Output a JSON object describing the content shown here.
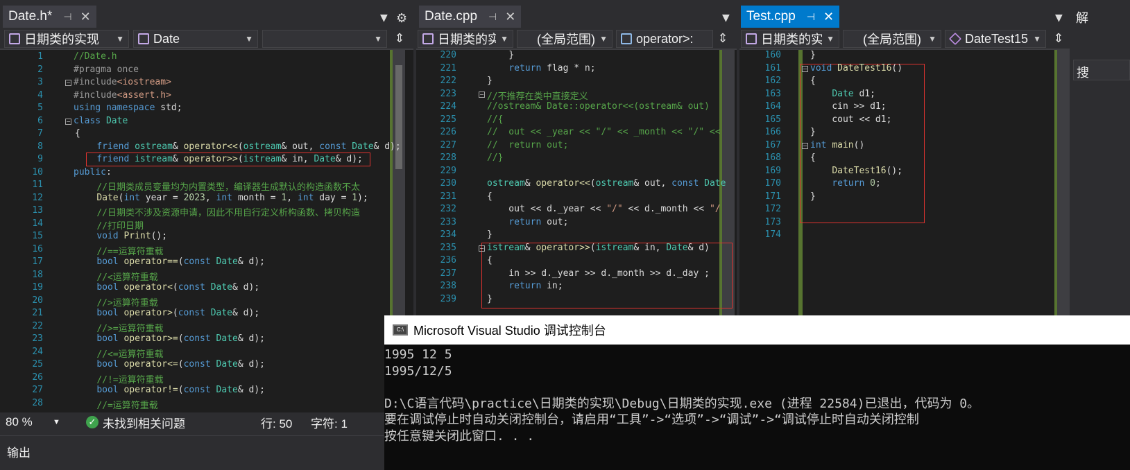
{
  "panes": [
    {
      "tab": "Date.h*",
      "active": false,
      "nav": [
        "日期类的实现",
        "Date",
        ""
      ],
      "lines": [
        {
          "n": 1,
          "code": "<span class='cm'>//Date.h</span>"
        },
        {
          "n": 2,
          "code": "<span class='pp'>#pragma once</span>"
        },
        {
          "n": 3,
          "code": "<span class='pp'>#include</span><span class='st'>&lt;iostream&gt;</span>"
        },
        {
          "n": 4,
          "code": "<span class='pp'>#include</span><span class='st'>&lt;assert.h&gt;</span>"
        },
        {
          "n": 5,
          "code": "<span class='kw'>using namespace</span> std;"
        },
        {
          "n": 6,
          "code": "<span class='kw'>class</span> <span class='ty'>Date</span>"
        },
        {
          "n": 7,
          "code": "{"
        },
        {
          "n": 8,
          "code": "    <span class='kw'>friend</span> <span class='ty'>ostream</span>&amp; <span class='fn'>operator&lt;&lt;</span>(<span class='ty'>ostream</span>&amp; out, <span class='kw'>const</span> <span class='ty'>Date</span>&amp; d);"
        },
        {
          "n": 9,
          "code": "    <span class='kw'>friend</span> <span class='ty'>istream</span>&amp; <span class='fn'>operator&gt;&gt;</span>(<span class='ty'>istream</span>&amp; in, <span class='ty'>Date</span>&amp; d);"
        },
        {
          "n": 10,
          "code": "<span class='kw'>public</span>:"
        },
        {
          "n": 11,
          "code": "    <span class='cm'>//日期类成员变量均为内置类型，编译器生成默认的构造函数不太</span>"
        },
        {
          "n": 12,
          "code": "    <span class='fn'>Date</span>(<span class='kw'>int</span> year = <span class='nu'>2023</span>, <span class='kw'>int</span> month = <span class='nu'>1</span>, <span class='kw'>int</span> day = <span class='nu'>1</span>);"
        },
        {
          "n": 13,
          "code": "    <span class='cm'>//日期类不涉及资源申请，因此不用自行定义析构函数、拷贝构造</span>"
        },
        {
          "n": 14,
          "code": "    <span class='cm'>//打印日期</span>"
        },
        {
          "n": 15,
          "code": "    <span class='kw'>void</span> <span class='fn'>Print</span>();"
        },
        {
          "n": 16,
          "code": "    <span class='cm'>//==运算符重载</span>"
        },
        {
          "n": 17,
          "code": "    <span class='kw'>bool</span> <span class='fn'>operator==</span>(<span class='kw'>const</span> <span class='ty'>Date</span>&amp; d);"
        },
        {
          "n": 18,
          "code": "    <span class='cm'>//&lt;运算符重载</span>"
        },
        {
          "n": 19,
          "code": "    <span class='kw'>bool</span> <span class='fn'>operator&lt;</span>(<span class='kw'>const</span> <span class='ty'>Date</span>&amp; d);"
        },
        {
          "n": 20,
          "code": "    <span class='cm'>//&gt;运算符重载</span>"
        },
        {
          "n": 21,
          "code": "    <span class='kw'>bool</span> <span class='fn'>operator&gt;</span>(<span class='kw'>const</span> <span class='ty'>Date</span>&amp; d);"
        },
        {
          "n": 22,
          "code": "    <span class='cm'>//&gt;=运算符重载</span>"
        },
        {
          "n": 23,
          "code": "    <span class='kw'>bool</span> <span class='fn'>operator&gt;=</span>(<span class='kw'>const</span> <span class='ty'>Date</span>&amp; d);"
        },
        {
          "n": 24,
          "code": "    <span class='cm'>//&lt;=运算符重载</span>"
        },
        {
          "n": 25,
          "code": "    <span class='kw'>bool</span> <span class='fn'>operator&lt;=</span>(<span class='kw'>const</span> <span class='ty'>Date</span>&amp; d);"
        },
        {
          "n": 26,
          "code": "    <span class='cm'>//!=运算符重载</span>"
        },
        {
          "n": 27,
          "code": "    <span class='kw'>bool</span> <span class='fn'>operator!=</span>(<span class='kw'>const</span> <span class='ty'>Date</span>&amp; d);"
        },
        {
          "n": 28,
          "code": "    <span class='cm'>//=运算符重载</span>"
        }
      ]
    },
    {
      "tab": "Date.cpp",
      "active": false,
      "nav": [
        "日期类的实",
        "(全局范围)",
        "operator>:"
      ],
      "lines": [
        {
          "n": 220,
          "code": "    }"
        },
        {
          "n": 221,
          "code": "    <span class='kw'>return</span> flag * n;"
        },
        {
          "n": 222,
          "code": "}"
        },
        {
          "n": 223,
          "code": "<span class='cm'>//不推荐在类中直接定义</span>"
        },
        {
          "n": 224,
          "code": "<span class='cm'>//ostream&amp; Date::operator&lt;&lt;(ostream&amp; out)</span>"
        },
        {
          "n": 225,
          "code": "<span class='cm'>//{</span>"
        },
        {
          "n": 226,
          "code": "<span class='cm'>//  out &lt;&lt; _year &lt;&lt; \"/\" &lt;&lt; _month &lt;&lt; \"/\" &lt;&lt;</span>"
        },
        {
          "n": 227,
          "code": "<span class='cm'>//  return out;</span>"
        },
        {
          "n": 228,
          "code": "<span class='cm'>//}</span>"
        },
        {
          "n": 229,
          "code": ""
        },
        {
          "n": 230,
          "code": "<span class='ty'>ostream</span>&amp; <span class='fn'>operator&lt;&lt;</span>(<span class='ty'>ostream</span>&amp; out, <span class='kw'>const</span> <span class='ty'>Date</span>"
        },
        {
          "n": 231,
          "code": "{"
        },
        {
          "n": 232,
          "code": "    out &lt;&lt; d.<span class='mem'>_year</span> &lt;&lt; <span class='st'>\"/\"</span> &lt;&lt; d.<span class='mem'>_month</span> &lt;&lt; <span class='st'>\"/</span>"
        },
        {
          "n": 233,
          "code": "    <span class='kw'>return</span> out;"
        },
        {
          "n": 234,
          "code": "}"
        },
        {
          "n": 235,
          "code": "<span class='ty'>istream</span>&amp; <span class='fn'>operator&gt;&gt;</span>(<span class='ty'>istream</span>&amp; in, <span class='ty'>Date</span>&amp; d)"
        },
        {
          "n": 236,
          "code": "{"
        },
        {
          "n": 237,
          "code": "    in &gt;&gt; d.<span class='mem'>_year</span> &gt;&gt; d.<span class='mem'>_month</span> &gt;&gt; d.<span class='mem'>_day</span> ;"
        },
        {
          "n": 238,
          "code": "    <span class='kw'>return</span> in;"
        },
        {
          "n": 239,
          "code": "}"
        }
      ]
    },
    {
      "tab": "Test.cpp",
      "active": true,
      "nav": [
        "日期类的实现",
        "(全局范围)",
        "DateTest15"
      ],
      "lines": [
        {
          "n": 160,
          "code": "}"
        },
        {
          "n": 161,
          "code": "<span class='kw'>void</span> <span class='fn'>DateTest16</span>()"
        },
        {
          "n": 162,
          "code": "{"
        },
        {
          "n": 163,
          "code": "    <span class='ty'>Date</span> d1;"
        },
        {
          "n": 164,
          "code": "    cin &gt;&gt; d1;"
        },
        {
          "n": 165,
          "code": "    cout &lt;&lt; d1;"
        },
        {
          "n": 166,
          "code": "}"
        },
        {
          "n": 167,
          "code": "<span class='kw'>int</span> <span class='fn'>main</span>()"
        },
        {
          "n": 168,
          "code": "{"
        },
        {
          "n": 169,
          "code": "    <span class='fn'>DateTest16</span>();"
        },
        {
          "n": 170,
          "code": "    <span class='kw'>return</span> <span class='nu'>0</span>;"
        },
        {
          "n": 171,
          "code": "}"
        },
        {
          "n": 172,
          "code": ""
        },
        {
          "n": 173,
          "code": ""
        },
        {
          "n": 174,
          "code": ""
        }
      ]
    }
  ],
  "status": {
    "zoom": "80 %",
    "issues": "未找到相关问题",
    "row": "行: 50",
    "col": "字符: 1"
  },
  "output_label": "输出",
  "console": {
    "title": "Microsoft Visual Studio 调试控制台",
    "lines": [
      "1995 12 5",
      "1995/12/5",
      "",
      "D:\\C语言代码\\practice\\日期类的实现\\Debug\\日期类的实现.exe (进程 22584)已退出，代码为 0。",
      "要在调试停止时自动关闭控制台，请启用“工具”->“选项”->“调试”->“调试停止时自动关闭控制",
      "按任意键关闭此窗口. . ."
    ]
  },
  "right_strip": [
    "解",
    "搜"
  ]
}
